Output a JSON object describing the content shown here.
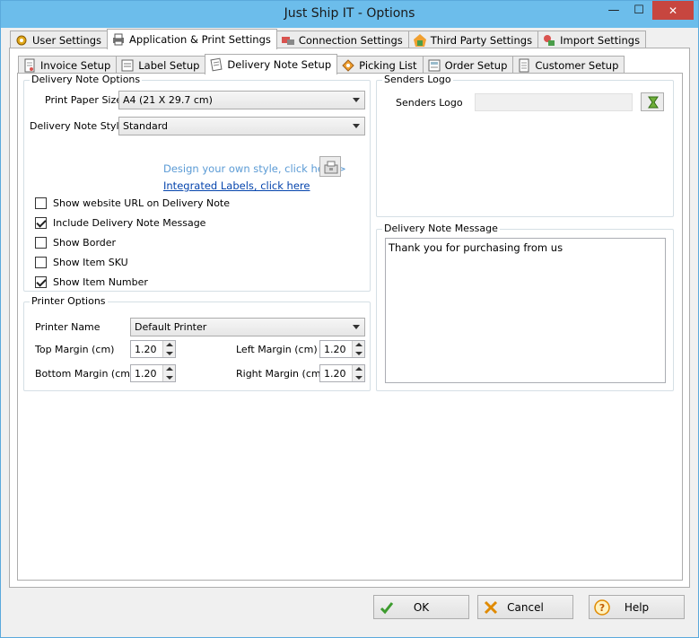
{
  "window": {
    "title": "Just Ship IT - Options",
    "min": "—",
    "max": "☐",
    "close": "✕"
  },
  "colors": {
    "accent": "#6cbdeb",
    "close": "#c7463f",
    "link": "#0645ad",
    "link_hint": "#5b9bd5"
  },
  "top_tabs": [
    {
      "label": "User Settings",
      "icon": "users-gear-icon"
    },
    {
      "label": "Application & Print Settings",
      "icon": "printer-icon",
      "active": true
    },
    {
      "label": "Connection Settings",
      "icon": "connection-icon"
    },
    {
      "label": "Third Party Settings",
      "icon": "third-party-icon"
    },
    {
      "label": "Import Settings",
      "icon": "import-icon"
    }
  ],
  "sub_tabs": [
    {
      "label": "Invoice Setup",
      "icon": "invoice-icon"
    },
    {
      "label": "Label Setup",
      "icon": "label-icon"
    },
    {
      "label": "Delivery Note Setup",
      "icon": "delivery-note-icon",
      "active": true
    },
    {
      "label": "Picking List",
      "icon": "picking-list-icon"
    },
    {
      "label": "Order Setup",
      "icon": "order-icon"
    },
    {
      "label": "Customer Setup",
      "icon": "customer-icon"
    }
  ],
  "delivery_options": {
    "legend": "Delivery Note Options",
    "paper_size_label": "Print Paper Size",
    "paper_size_value": "A4 (21 X 29.7 cm)",
    "style_label": "Delivery Note Style",
    "style_value": "Standard",
    "design_link": "Design your own style, click here >",
    "integrated_link": "Integrated Labels, click here",
    "checks": [
      {
        "label": "Show website URL on Delivery Note",
        "checked": false
      },
      {
        "label": "Include Delivery Note Message",
        "checked": true
      },
      {
        "label": "Show Border",
        "checked": false
      },
      {
        "label": "Show Item SKU",
        "checked": false
      },
      {
        "label": "Show Item Number",
        "checked": true
      }
    ]
  },
  "printer_options": {
    "legend": "Printer Options",
    "printer_name_label": "Printer Name",
    "printer_name_value": "Default Printer",
    "top_margin_label": "Top Margin (cm)",
    "top_margin_value": "1.20",
    "left_margin_label": "Left Margin (cm)",
    "left_margin_value": "1.20",
    "bottom_margin_label": "Bottom Margin (cm)",
    "bottom_margin_value": "1.20",
    "right_margin_label": "Right Margin (cm)",
    "right_margin_value": "1.20"
  },
  "senders_logo": {
    "legend": "Senders Logo",
    "label": "Senders Logo",
    "value": ""
  },
  "delivery_message": {
    "legend": "Delivery Note Message",
    "text": "Thank you for purchasing from us"
  },
  "buttons": {
    "ok": "OK",
    "cancel": "Cancel",
    "help": "Help"
  }
}
